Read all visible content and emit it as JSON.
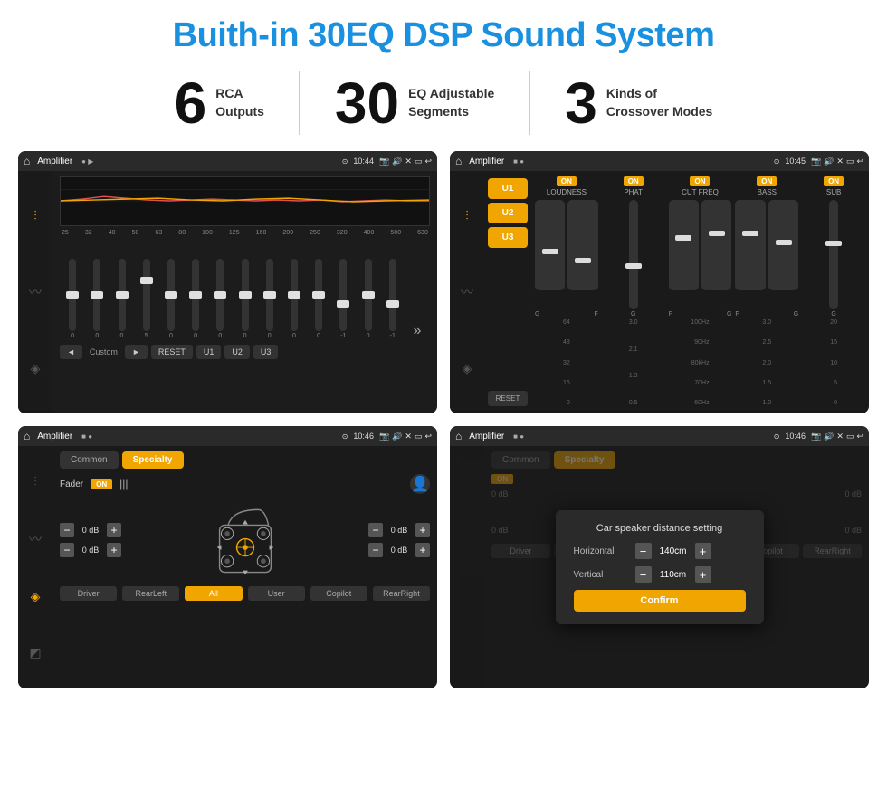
{
  "title": "Buith-in 30EQ DSP Sound System",
  "features": [
    {
      "number": "6",
      "line1": "RCA",
      "line2": "Outputs"
    },
    {
      "number": "30",
      "line1": "EQ Adjustable",
      "line2": "Segments"
    },
    {
      "number": "3",
      "line1": "Kinds of",
      "line2": "Crossover Modes"
    }
  ],
  "screens": {
    "eq": {
      "statusBar": {
        "title": "Amplifier",
        "time": "10:44"
      },
      "freqLabels": [
        "25",
        "32",
        "40",
        "50",
        "63",
        "80",
        "100",
        "125",
        "160",
        "200",
        "250",
        "320",
        "400",
        "500",
        "630"
      ],
      "sliderValues": [
        "0",
        "0",
        "0",
        "5",
        "0",
        "0",
        "0",
        "0",
        "0",
        "0",
        "0",
        "-1",
        "0",
        "-1"
      ],
      "controls": [
        "◄",
        "Custom",
        "►",
        "RESET",
        "U1",
        "U2",
        "U3"
      ]
    },
    "amplifier": {
      "statusBar": {
        "title": "Amplifier",
        "time": "10:45"
      },
      "uButtons": [
        "U1",
        "U2",
        "U3"
      ],
      "resetLabel": "RESET",
      "channels": [
        {
          "label": "LOUDNESS",
          "on": true
        },
        {
          "label": "PHAT",
          "on": true
        },
        {
          "label": "CUT FREQ",
          "on": true
        },
        {
          "label": "BASS",
          "on": true
        },
        {
          "label": "SUB",
          "on": true
        }
      ]
    },
    "fader": {
      "statusBar": {
        "title": "Amplifier",
        "time": "10:46"
      },
      "tabs": [
        "Common",
        "Specialty"
      ],
      "activeTab": "Specialty",
      "faderLabel": "Fader",
      "onBadge": "ON",
      "dbValues": [
        "0 dB",
        "0 dB",
        "0 dB",
        "0 dB"
      ],
      "positions": [
        "Driver",
        "RearLeft",
        "All",
        "User",
        "Copilot",
        "RearRight"
      ]
    },
    "dialog": {
      "statusBar": {
        "title": "Amplifier",
        "time": "10:46"
      },
      "tabs": [
        "Common",
        "Specialty"
      ],
      "onBadge": "ON",
      "dialogTitle": "Car speaker distance setting",
      "horizontal": {
        "label": "Horizontal",
        "value": "140cm"
      },
      "vertical": {
        "label": "Vertical",
        "value": "110cm"
      },
      "confirmLabel": "Confirm",
      "dbValues": [
        "0 dB",
        "0 dB"
      ],
      "positions": [
        "Driver",
        "RearLeft",
        "All",
        "User",
        "Copilot",
        "RearRight"
      ]
    }
  },
  "icons": {
    "home": "⌂",
    "play": "▶",
    "pause": "⏸",
    "location": "⊙",
    "camera": "📷",
    "volume": "🔊",
    "close": "✕",
    "minimize": "—",
    "back": "↩",
    "equalizer": "≋",
    "waveform": "≈",
    "speaker": "◉",
    "settings": "⚙",
    "person": "👤",
    "chevron-up": "▲",
    "chevron-down": "▼",
    "chevron-left": "◄",
    "chevron-right": "►"
  }
}
